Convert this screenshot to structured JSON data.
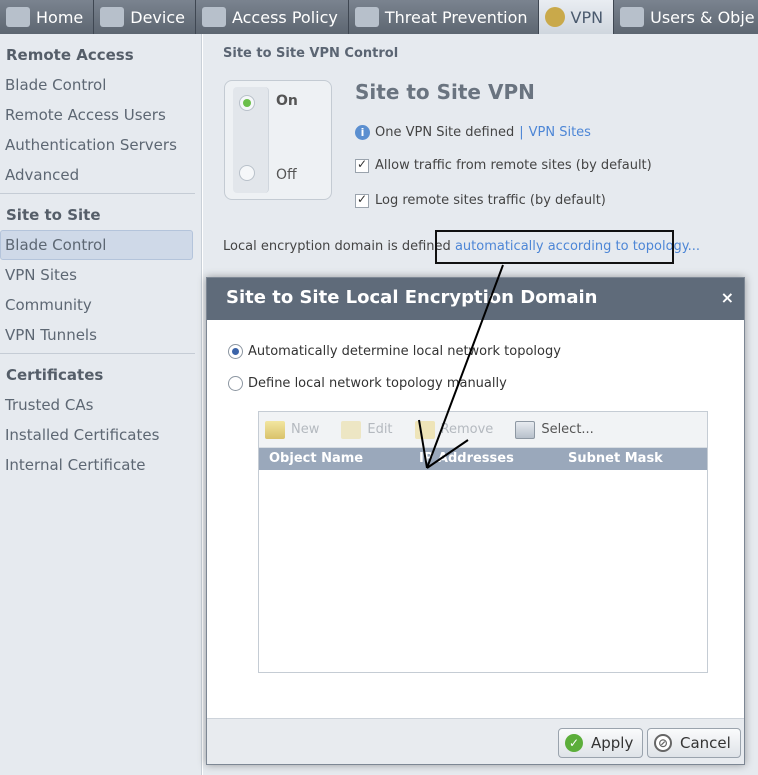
{
  "tabs": [
    {
      "label": "Home",
      "icon": "home-icon"
    },
    {
      "label": "Device",
      "icon": "device-icon"
    },
    {
      "label": "Access Policy",
      "icon": "access-policy-icon"
    },
    {
      "label": "Threat Prevention",
      "icon": "shield-icon"
    },
    {
      "label": "VPN",
      "icon": "vpn-icon",
      "active": true
    },
    {
      "label": "Users & Obje",
      "icon": "users-icon"
    }
  ],
  "sidebar": {
    "remote_access": {
      "title": "Remote Access",
      "items": [
        "Blade Control",
        "Remote Access Users",
        "Authentication Servers",
        "Advanced"
      ]
    },
    "site_to_site": {
      "title": "Site to Site",
      "items": [
        "Blade Control",
        "VPN Sites",
        "Community",
        "VPN Tunnels"
      ],
      "selected": 0
    },
    "certificates": {
      "title": "Certificates",
      "items": [
        "Trusted CAs",
        "Installed Certificates",
        "Internal Certificate"
      ]
    }
  },
  "main": {
    "section_title": "Site to Site VPN Control",
    "toggle": {
      "on_label": "On",
      "off_label": "Off",
      "state": "On"
    },
    "title": "Site to Site VPN",
    "info_text": "One VPN Site defined",
    "info_link": "VPN Sites",
    "allow_traffic": {
      "label": "Allow traffic from remote sites (by default)",
      "checked": true
    },
    "log_traffic": {
      "label": "Log remote sites traffic (by default)",
      "checked": true
    },
    "encryption_prefix": "Local encryption domain is defined",
    "encryption_link": "automatically according to topology..."
  },
  "dialog": {
    "title": "Site to Site Local Encryption Domain",
    "close": "×",
    "option_auto": "Automatically determine local network topology",
    "option_manual": "Define local network topology manually",
    "selected_option": "auto",
    "toolbar": {
      "new": "New",
      "edit": "Edit",
      "remove": "Remove",
      "select": "Select..."
    },
    "columns": [
      "Object Name",
      "IP Addresses",
      "Subnet Mask"
    ],
    "rows": [],
    "apply": "Apply",
    "cancel": "Cancel"
  },
  "colors": {
    "accent_link": "#4d86d6",
    "dialog_header": "#5f6b7a",
    "table_header": "#9aa8bb",
    "selected_item": "#cfd9e8"
  }
}
